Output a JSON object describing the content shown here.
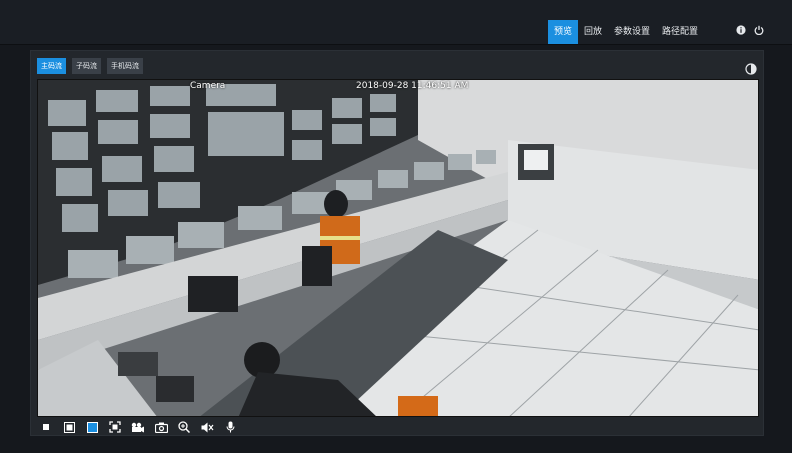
{
  "nav": {
    "tabs": [
      {
        "label": "预览",
        "active": true
      },
      {
        "label": "回放",
        "active": false
      },
      {
        "label": "参数设置",
        "active": false
      },
      {
        "label": "路径配置",
        "active": false
      }
    ],
    "icons": [
      "info-icon",
      "power-icon"
    ]
  },
  "stream": {
    "tabs": [
      {
        "label": "主码流",
        "active": true
      },
      {
        "label": "子码流",
        "active": false
      },
      {
        "label": "手机码流",
        "active": false
      }
    ]
  },
  "video": {
    "camera_label": "Camera",
    "timestamp": "2018-09-28 11:46:51 AM",
    "scene": "control-room-camera-feed"
  },
  "toolbar": {
    "buttons": [
      "stop-icon",
      "window-single-icon",
      "window-fill-icon",
      "fullscreen-icon",
      "record-icon",
      "snapshot-icon",
      "zoom-icon",
      "mute-icon",
      "microphone-icon"
    ]
  },
  "colors": {
    "accent": "#1b8fe0",
    "background": "#15181d",
    "panel": "#23272c"
  }
}
